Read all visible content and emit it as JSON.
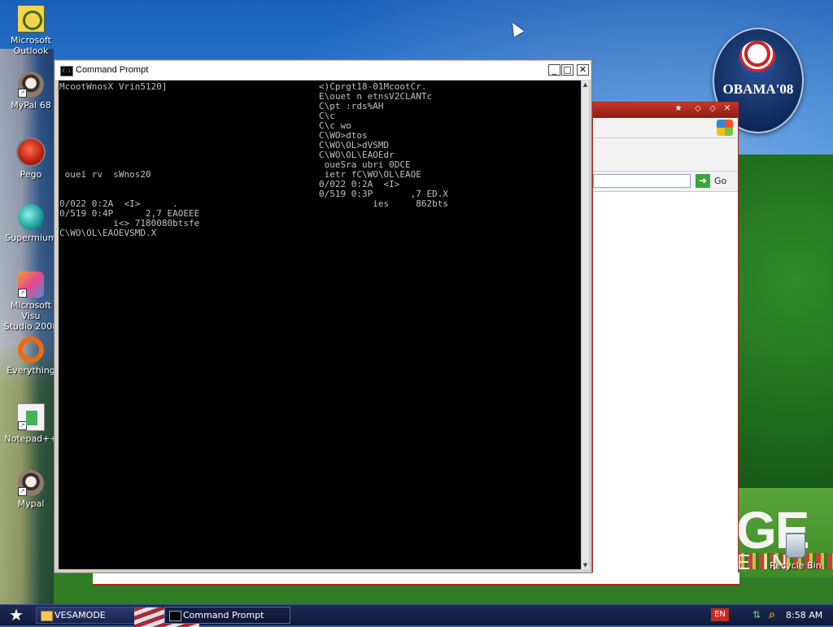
{
  "desktop": {
    "icons": [
      {
        "label": "Microsoft\nOutlook",
        "icon": "outlook-icon"
      },
      {
        "label": "MyPal 68",
        "icon": "raccoon-icon"
      },
      {
        "label": "Pego",
        "icon": "pego-icon"
      },
      {
        "label": "Supermium",
        "icon": "supermium-icon"
      },
      {
        "label": "Microsoft Visu\nStudio 2008",
        "icon": "visual-studio-icon"
      },
      {
        "label": "Everything",
        "icon": "everything-icon"
      },
      {
        "label": "Notepad++",
        "icon": "notepad-plus-plus-icon"
      },
      {
        "label": "Mypal",
        "icon": "raccoon-icon"
      }
    ],
    "recycle_bin": {
      "label": "Recycle Bin",
      "icon": "recycle-bin-icon"
    }
  },
  "wallpaper": {
    "badge_text": "OBAMA'08",
    "big_text": "GE",
    "big_text_2": "E IN"
  },
  "browser": {
    "go_label": "Go"
  },
  "cmd_window": {
    "title": "Command Prompt",
    "icon": "cmd-icon",
    "buttons": {
      "minimize": "_",
      "maximize": "□",
      "close": "✕"
    },
    "left_column": "McootWnosX Vrin5120]\n\n\n\n\n\n\n\n\n oueï rv  sWnos20\n\n\n0/022 0:2A  <I>      .\n0/519 0:4P      2,7 EAOEEE\n          i<> 7180080btsfe\nC\\WO\\OL\\EAOEVSMD.X",
    "right_column": "<)Cprgt18-01McootCr.\nE\\ouet n etnsV2CLANTc\nC\\pt :rds%AH\nC\\c\nC\\c wo\nC\\WO>dtos\nC\\WO\\OL>dVSMD\nC\\WO\\OL\\EAOEdr\n oueSra ubri 0DCE\n ietr fC\\WO\\OL\\EAOE\n0/022 0:2A  <I>\n0/519 0:3P       ,7 ED.X\n          ies     862bts"
  },
  "taskbar": {
    "start_icon": "star-start-icon",
    "items": [
      {
        "label": "VESAMODE",
        "icon": "folder-icon",
        "active": false
      },
      {
        "label": "Command Prompt",
        "icon": "cmd-icon",
        "active": true
      }
    ],
    "tray": {
      "language": "EN",
      "clock": "8:58 AM"
    }
  }
}
